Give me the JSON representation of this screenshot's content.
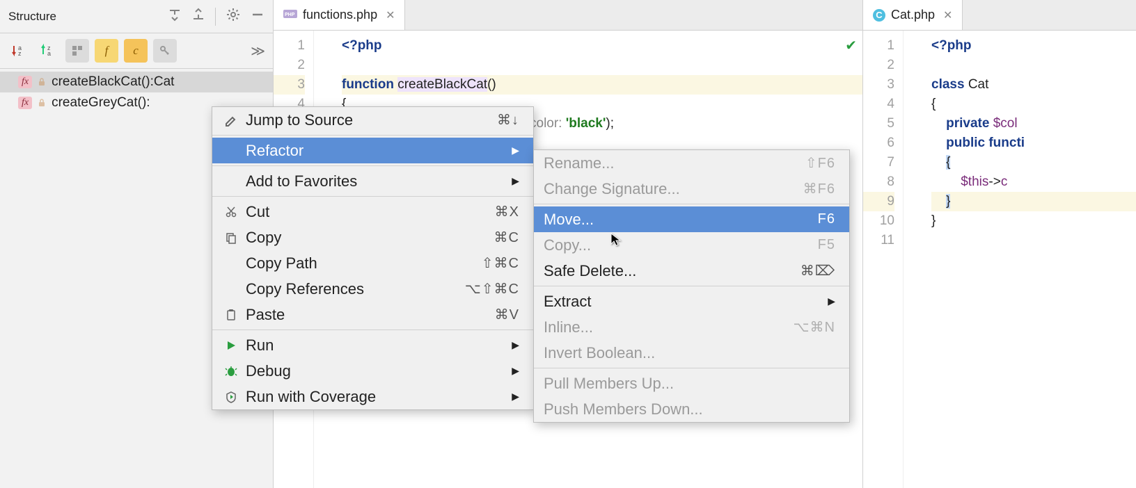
{
  "structure": {
    "title": "Structure",
    "toolbar": {
      "sort_icon": "⇅",
      "f_letter": "f",
      "c_letter": "c"
    },
    "items": [
      {
        "label": "createBlackCat():Cat",
        "selected": true
      },
      {
        "label": "createGreyCat():"
      }
    ]
  },
  "tabs": {
    "left": {
      "name": "functions.php"
    },
    "right": {
      "name": "Cat.php"
    }
  },
  "editor_left": {
    "lines": [
      "1",
      "2",
      "3",
      "4"
    ],
    "l1_open": "<?php",
    "l3_kw": "function",
    "l3_name": "createBlackCat",
    "l3_parens": "()",
    "l4": "{",
    "l5_param": "color:",
    "l5_str": "'black'",
    "l5_end": ");"
  },
  "editor_right": {
    "lines": [
      "1",
      "2",
      "3",
      "4",
      "5",
      "6",
      "7",
      "8",
      "9",
      "10",
      "11"
    ],
    "l1_open": "<?php",
    "l3_kw": "class",
    "l3_name": "Cat",
    "l4": "{",
    "l5_kw": "private",
    "l5_var": "$col",
    "l6_kw": "public",
    "l6_rest": "functi",
    "l7": "{",
    "l8_this": "$this",
    "l8_arrow": "->",
    "l8_c": "c",
    "l9": "}",
    "l10": "}"
  },
  "context_menu": {
    "jump": {
      "label": "Jump to Source",
      "shortcut": "⌘↓"
    },
    "refactor": "Refactor",
    "favorites": "Add to Favorites",
    "cut": {
      "label": "Cut",
      "shortcut": "⌘X"
    },
    "copy": {
      "label": "Copy",
      "shortcut": "⌘C"
    },
    "copy_path": {
      "label": "Copy Path",
      "shortcut": "⇧⌘C"
    },
    "copy_refs": {
      "label": "Copy References",
      "shortcut": "⌥⇧⌘C"
    },
    "paste": {
      "label": "Paste",
      "shortcut": "⌘V"
    },
    "run": "Run",
    "debug": "Debug",
    "coverage": "Run with Coverage"
  },
  "submenu": {
    "rename": {
      "label": "Rename...",
      "shortcut": "⇧F6"
    },
    "change_sig": {
      "label": "Change Signature...",
      "shortcut": "⌘F6"
    },
    "move": {
      "label": "Move...",
      "shortcut": "F6"
    },
    "copy": {
      "label": "Copy...",
      "shortcut": "F5"
    },
    "safe_delete": {
      "label": "Safe Delete...",
      "shortcut": "⌘⌦"
    },
    "extract": "Extract",
    "inline": {
      "label": "Inline...",
      "shortcut": "⌥⌘N"
    },
    "invert": "Invert Boolean...",
    "pull_up": "Pull Members Up...",
    "push_down": "Push Members Down..."
  }
}
